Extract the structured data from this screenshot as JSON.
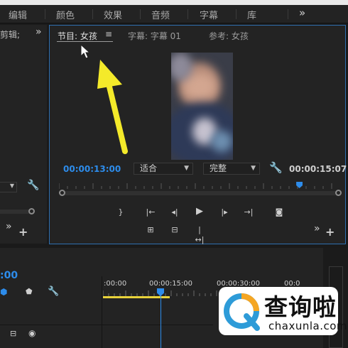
{
  "menu_bar": {
    "items": [
      "编辑",
      "颜色",
      "效果",
      "音频",
      "字幕",
      "库"
    ],
    "more_icon": "double-chevron-right"
  },
  "left_panel": {
    "tab_label": "剪辑;",
    "more_icon": "double-chevron-right"
  },
  "program_monitor": {
    "tabs": [
      "节目: 女孩",
      "字幕: 字幕 01",
      "参考: 女孩"
    ],
    "tab_menu_icon": "hamburger-menu",
    "current_timecode": "00:00:13:00",
    "duration_timecode": "00:00:15:07",
    "zoom_select": "适合",
    "quality_select": "完整",
    "settings_icon": "wrench",
    "transport_icons": [
      "mark-out",
      "go-to-in",
      "step-back",
      "play",
      "step-forward",
      "go-to-out",
      "export-frame"
    ],
    "secondary_icons": [
      "lift",
      "extract",
      "comparison-view"
    ],
    "playhead_position_fraction": 0.86
  },
  "timeline": {
    "timecode": ":00",
    "ruler_labels": [
      ":00:00",
      "00:00:15:00",
      "00:00:30:00",
      "00:0"
    ]
  },
  "watermark": {
    "main_text": "查询啦",
    "sub_text": "chaxunla.com"
  },
  "colors": {
    "accent_blue": "#2d8ceb",
    "annotation_arrow": "#f4ea2a",
    "work_area": "#e8d23a"
  }
}
